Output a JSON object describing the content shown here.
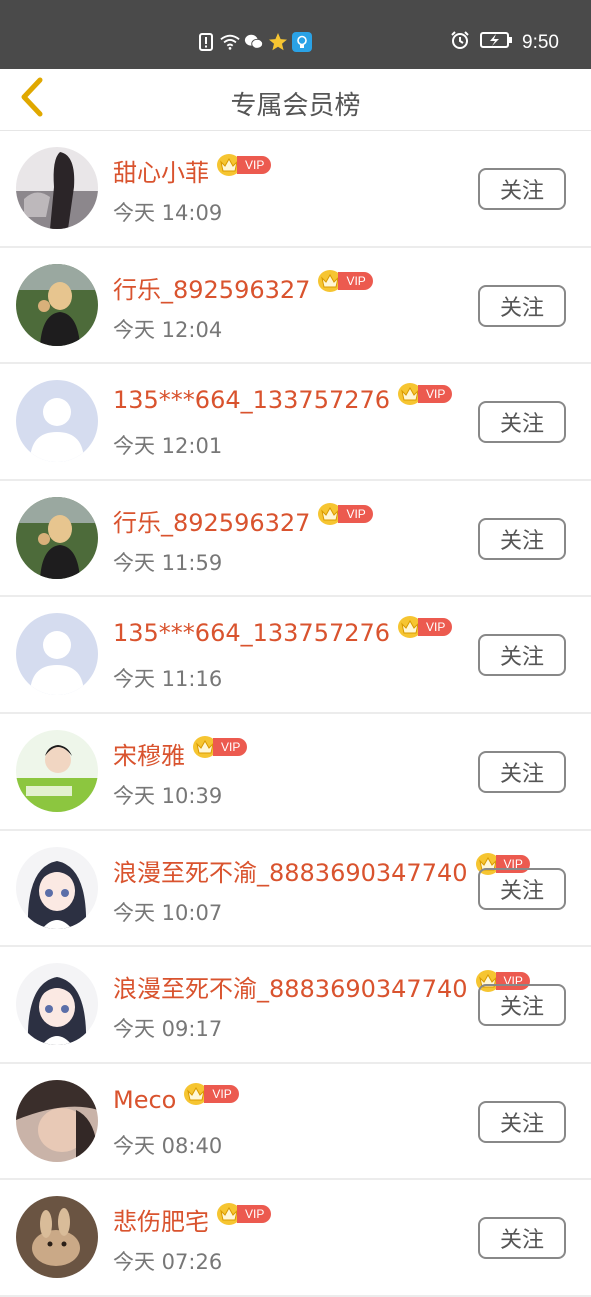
{
  "status_bar": {
    "time": "9:50",
    "icons": [
      "sim-alert-icon",
      "wifi-icon",
      "wechat-icon",
      "star-app-icon",
      "lightbulb-app-icon",
      "alarm-icon",
      "battery-charging-icon"
    ]
  },
  "header": {
    "title": "专属会员榜",
    "back_icon": "chevron-left-icon"
  },
  "badge_text": "VIP",
  "follow_label": "关注",
  "members": [
    {
      "name": "甜心小菲",
      "time": "今天 14:09",
      "avatar": "photo-girl-dark"
    },
    {
      "name": "行乐_892596327",
      "time": "今天 12:04",
      "avatar": "photo-outdoor"
    },
    {
      "name": "135***664_133757276",
      "time": "今天 12:01",
      "avatar": "default-avatar"
    },
    {
      "name": "行乐_892596327",
      "time": "今天 11:59",
      "avatar": "photo-outdoor"
    },
    {
      "name": "135***664_133757276",
      "time": "今天 11:16",
      "avatar": "default-avatar"
    },
    {
      "name": "宋穆雅",
      "time": "今天 10:39",
      "avatar": "photo-green"
    },
    {
      "name": "浪漫至死不渝_8883690347740",
      "time": "今天 10:07",
      "avatar": "anime-girl"
    },
    {
      "name": "浪漫至死不渝_8883690347740",
      "time": "今天 09:17",
      "avatar": "anime-girl"
    },
    {
      "name": "Meco",
      "time": "今天 08:40",
      "avatar": "photo-selfie"
    },
    {
      "name": "悲伤肥宅",
      "time": "今天 07:26",
      "avatar": "photo-bunny"
    }
  ],
  "colors": {
    "status_bar": "#4a4a4a",
    "name": "#d9532e",
    "vip_tag": "#ec5a4f",
    "crown": "#f6c531",
    "back_arrow": "#e0a800"
  }
}
